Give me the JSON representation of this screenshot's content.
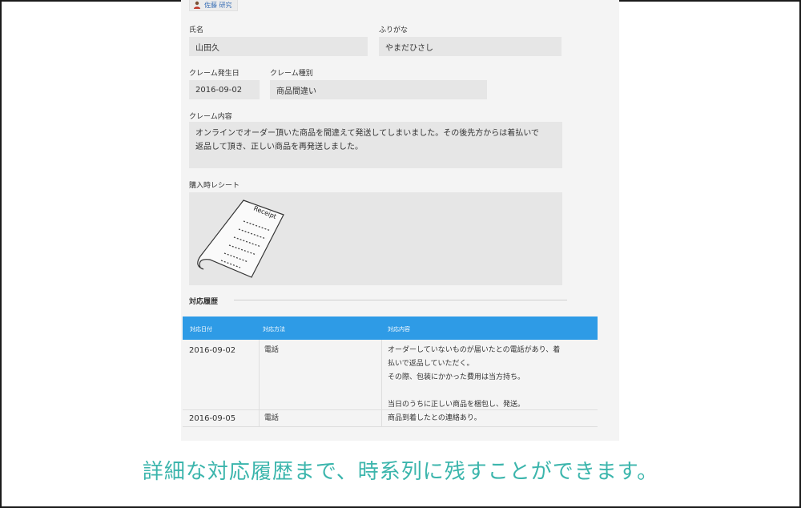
{
  "header": {
    "user_name": "佐藤 研究"
  },
  "form": {
    "name_label": "氏名",
    "name_value": "山田久",
    "furigana_label": "ふりがな",
    "furigana_value": "やまだひさし",
    "claim_date_label": "クレーム発生日",
    "claim_date_value": "2016-09-02",
    "claim_type_label": "クレーム種別",
    "claim_type_value": "商品間違い",
    "claim_content_label": "クレーム内容",
    "claim_content_line1": "オンラインでオーダー頂いた商品を間違えて発送してしまいました。その後先方からは着払いで",
    "claim_content_line2": "返品して頂き、正しい商品を再発送しました。",
    "receipt_label": "購入時レシート",
    "receipt_image_text": "Receipt"
  },
  "history": {
    "title": "対応履歴",
    "columns": [
      "対応日付",
      "対応方法",
      "対応内容"
    ],
    "rows": [
      {
        "date": "2016-09-02",
        "method": "電話",
        "lines": [
          "オーダーしていないものが届いたとの電話があり、着",
          "払いで返品していただく。",
          "その際、包装にかかった費用は当方持ち。",
          "",
          "当日のうちに正しい商品を梱包し、発送。"
        ]
      },
      {
        "date": "2016-09-05",
        "method": "電話",
        "lines": [
          "商品到着したとの連絡あり。"
        ]
      }
    ]
  },
  "caption": "詳細な対応履歴まで、時系列に残すことができます。",
  "colors": {
    "table_header": "#2e9be6",
    "caption": "#3bb5ac",
    "panel": "#f4f4f4",
    "field": "#e6e6e6"
  }
}
